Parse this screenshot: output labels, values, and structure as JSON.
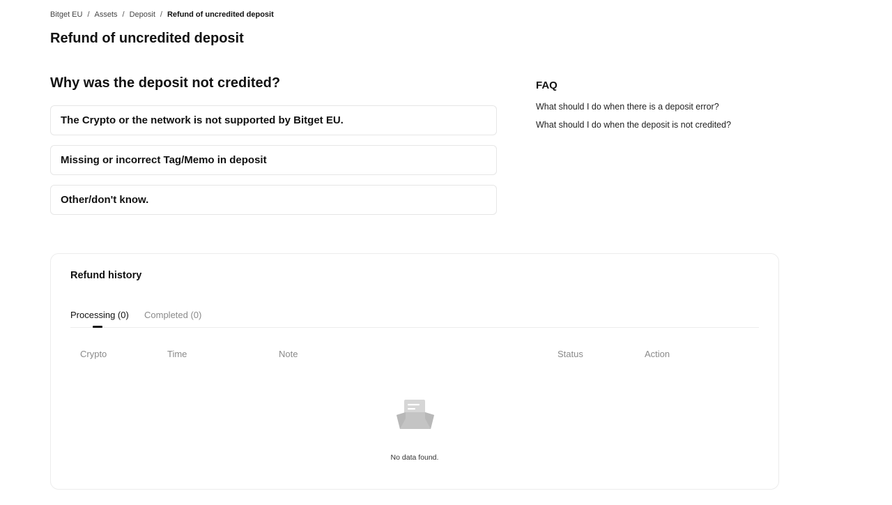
{
  "breadcrumb": {
    "items": [
      "Bitget EU",
      "Assets",
      "Deposit"
    ],
    "current": "Refund of uncredited deposit",
    "separator": "/"
  },
  "page_title": "Refund of uncredited deposit",
  "why": {
    "title": "Why was the deposit not credited?",
    "reasons": [
      "The Crypto or the network is not supported by Bitget EU.",
      "Missing or incorrect Tag/Memo in deposit",
      "Other/don't know."
    ]
  },
  "faq": {
    "title": "FAQ",
    "links": [
      "What should I do when there is a deposit error?",
      "What should I do when the deposit is not credited?"
    ]
  },
  "history": {
    "title": "Refund history",
    "tabs": [
      {
        "label": "Processing (0)",
        "active": true
      },
      {
        "label": "Completed (0)",
        "active": false
      }
    ],
    "columns": [
      "Crypto",
      "Time",
      "Note",
      "Status",
      "Action"
    ],
    "empty_text": "No data found.",
    "empty_icon": "empty-document-icon"
  },
  "colors": {
    "text_primary": "#111111",
    "text_muted": "#8a8a8a",
    "border": "#e6e6e6"
  }
}
